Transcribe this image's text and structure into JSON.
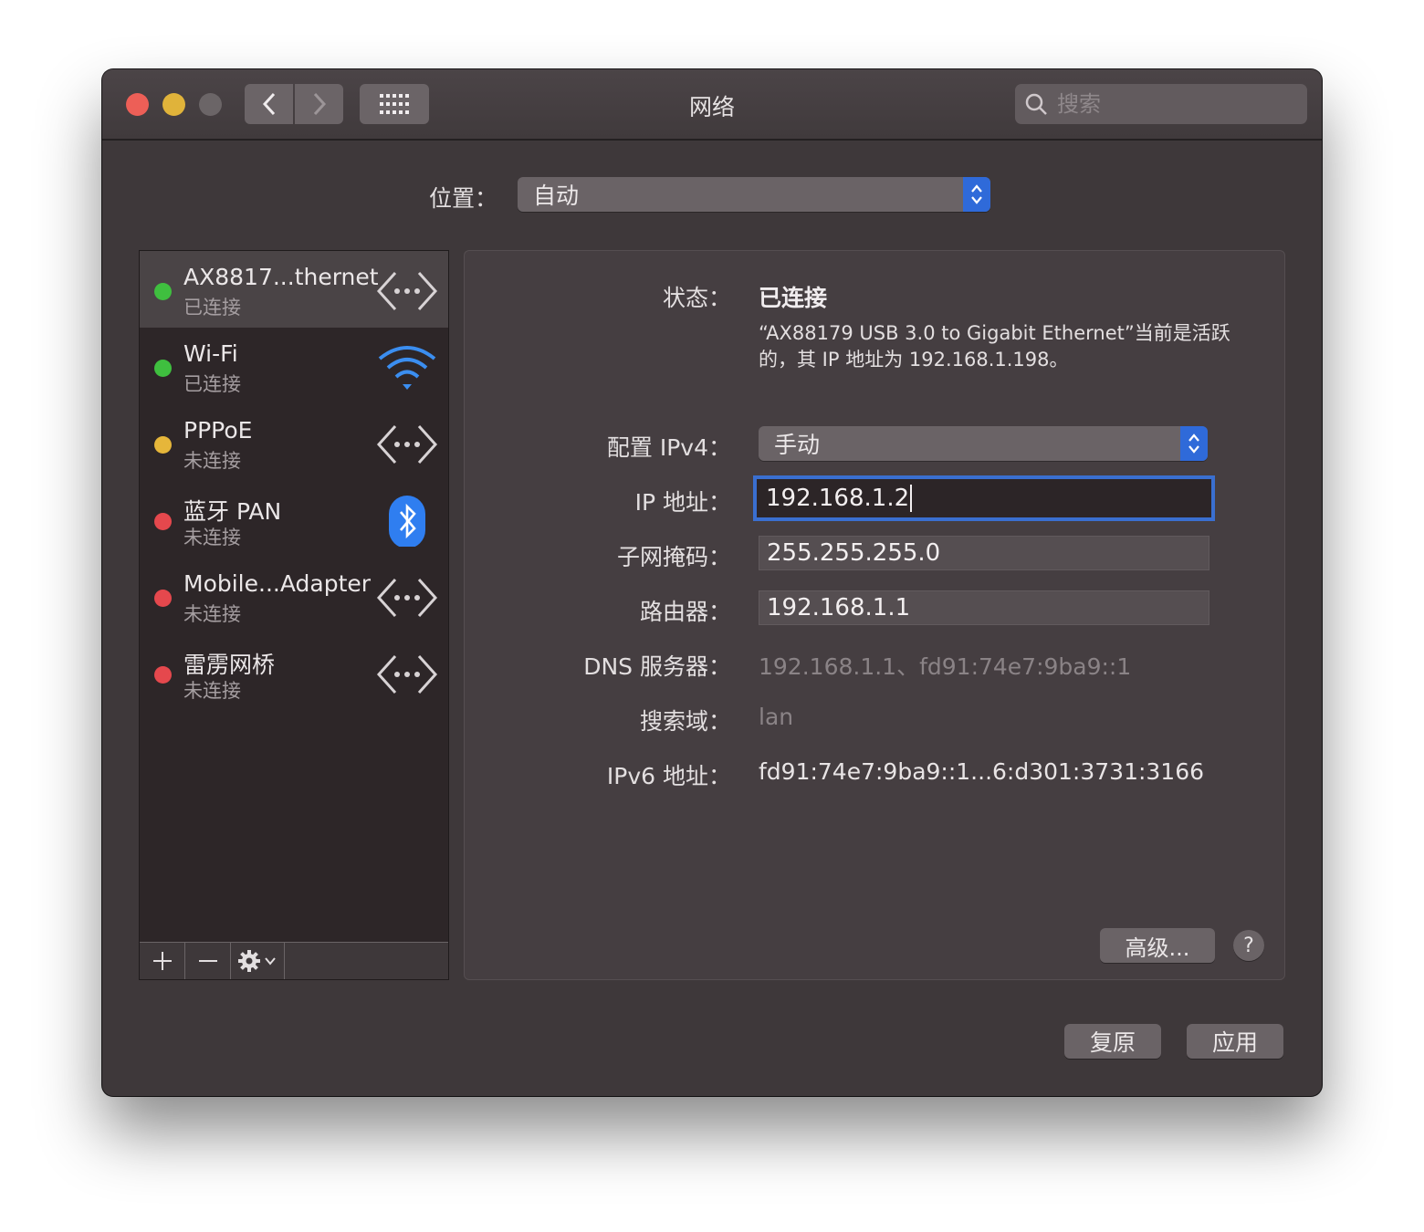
{
  "window": {
    "title": "网络"
  },
  "search": {
    "placeholder": "搜索"
  },
  "location": {
    "label": "位置：",
    "value": "自动"
  },
  "services": [
    {
      "name": "AX8817...thernet",
      "status": "已连接",
      "dot_color": "#3fbf3f",
      "icon": "ethernet-icon",
      "selected": true
    },
    {
      "name": "Wi-Fi",
      "status": "已连接",
      "dot_color": "#3fbf3f",
      "icon": "wifi-icon",
      "selected": false
    },
    {
      "name": "PPPoE",
      "status": "未连接",
      "dot_color": "#e6b63a",
      "icon": "ethernet-icon",
      "selected": false
    },
    {
      "name": "蓝牙 PAN",
      "status": "未连接",
      "dot_color": "#e5484d",
      "icon": "bluetooth-icon",
      "selected": false
    },
    {
      "name": "Mobile...Adapter",
      "status": "未连接",
      "dot_color": "#e5484d",
      "icon": "ethernet-icon",
      "selected": false
    },
    {
      "name": "雷雳网桥",
      "status": "未连接",
      "dot_color": "#e5484d",
      "icon": "ethernet-icon",
      "selected": false
    }
  ],
  "toolbar": {
    "add": "+",
    "remove": "—",
    "gear_icon": "gear-icon"
  },
  "detail": {
    "status_label": "状态：",
    "status_value": "已连接",
    "status_desc": "“AX88179 USB 3.0 to Gigabit Ethernet”当前是活跃的，其 IP 地址为 192.168.1.198。",
    "config_label": "配置 IPv4：",
    "config_value": "手动",
    "ip_label": "IP 地址：",
    "ip_value": "192.168.1.2",
    "subnet_label": "子网掩码：",
    "subnet_value": "255.255.255.0",
    "router_label": "路由器：",
    "router_value": "192.168.1.1",
    "dns_label": "DNS 服务器：",
    "dns_value": "192.168.1.1、fd91:74e7:9ba9::1",
    "search_label": "搜索域：",
    "search_value": "lan",
    "ipv6_label": "IPv6 地址：",
    "ipv6_value": "fd91:74e7:9ba9::1...6:d301:3731:3166",
    "advanced": "高级...",
    "help": "?"
  },
  "buttons": {
    "revert": "复原",
    "apply": "应用"
  },
  "colors": {
    "accent": "#2f6ad9",
    "window_bg": "#3e383a"
  }
}
